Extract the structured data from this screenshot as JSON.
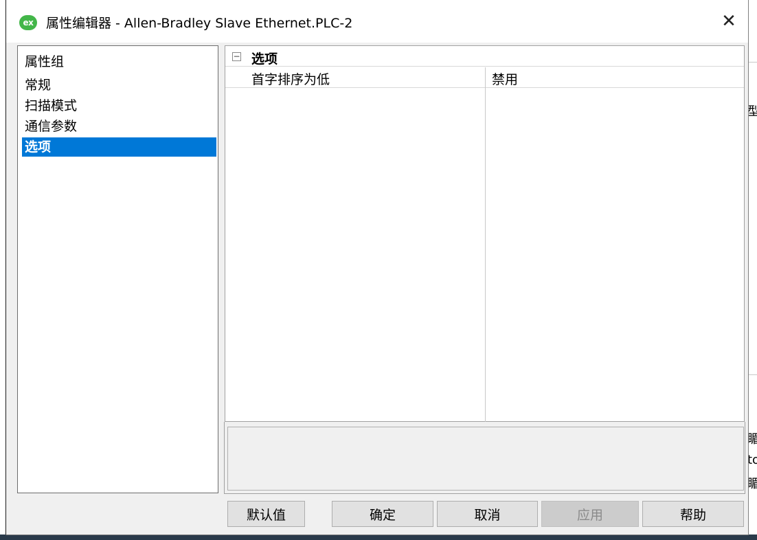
{
  "window": {
    "title": "属性编辑器 - Allen-Bradley Slave Ethernet.PLC-2",
    "app_icon_text": "ex",
    "close_glyph": "✕"
  },
  "property_groups": {
    "header": "属性组",
    "items": [
      {
        "label": "常规",
        "selected": false
      },
      {
        "label": "扫描模式",
        "selected": false
      },
      {
        "label": "通信参数",
        "selected": false
      },
      {
        "label": "选项",
        "selected": true
      }
    ]
  },
  "grid": {
    "collapse_glyph": "−",
    "section_label": "选项",
    "rows": [
      {
        "name": "首字排序为低",
        "value": "禁用"
      }
    ]
  },
  "buttons": {
    "defaults": "默认值",
    "ok": "确定",
    "cancel": "取消",
    "apply": "应用",
    "help": "帮助"
  },
  "background_fragments": [
    "型",
    "睸",
    "to",
    "睸"
  ],
  "colors": {
    "selection": "#0078d7",
    "app_icon": "#43b649"
  }
}
